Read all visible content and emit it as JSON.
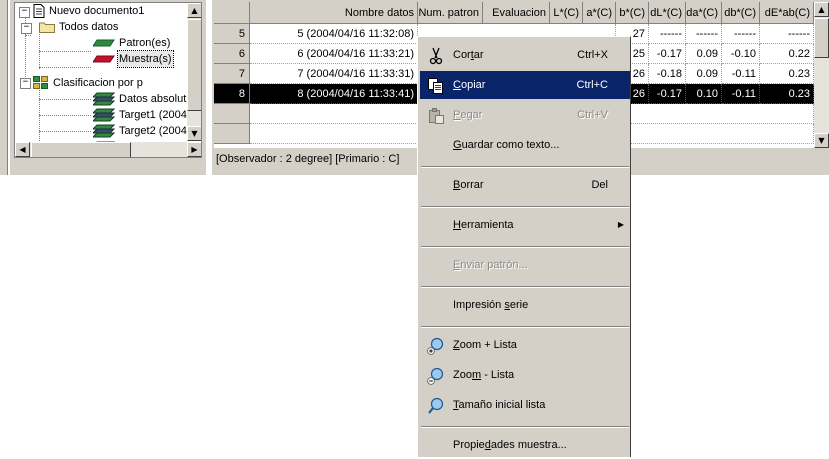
{
  "tree": {
    "nodes": [
      {
        "label": "Nuevo documento1",
        "icon": "document-icon"
      },
      {
        "label": "Todos datos",
        "icon": "folder-icon"
      },
      {
        "label": "Patron(es)",
        "icon": "green-swatch-icon"
      },
      {
        "label": "Muestra(s)",
        "icon": "red-swatch-icon"
      },
      {
        "label": "Clasificacion por p",
        "icon": "classification-icon"
      },
      {
        "label": "Datos absolut",
        "icon": "swatch-stack-icon"
      },
      {
        "label": "Target1 (2004",
        "icon": "swatch-stack-icon"
      },
      {
        "label": "Target2 (2004",
        "icon": "swatch-stack-icon"
      }
    ]
  },
  "grid": {
    "headers": [
      "Nombre datos",
      "Num. patron",
      "Evaluacion",
      "L*(C)",
      "a*(C)",
      "b*(C)",
      "dL*(C)",
      "da*(C)",
      "db*(C)",
      "dE*ab(C)"
    ],
    "rows": [
      {
        "num": "5",
        "name": "5 (2004/04/16 11:32:08)",
        "b": "27",
        "dL": "------",
        "da": "------",
        "db": "------",
        "dE": "------"
      },
      {
        "num": "6",
        "name": "6 (2004/04/16 11:33:21)",
        "b": "25",
        "dL": "-0.17",
        "da": "0.09",
        "db": "-0.10",
        "dE": "0.22"
      },
      {
        "num": "7",
        "name": "7 (2004/04/16 11:33:31)",
        "b": "26",
        "dL": "-0.18",
        "da": "0.09",
        "db": "-0.11",
        "dE": "0.23"
      },
      {
        "num": "8",
        "name": "8 (2004/04/16 11:33:41)",
        "b": "26",
        "dL": "-0.17",
        "da": "0.10",
        "db": "-0.11",
        "dE": "0.23"
      }
    ],
    "status": "[Observador : 2 degree]  [Primario : C]"
  },
  "menu": {
    "cut": {
      "pre": "Cor",
      "u": "t",
      "post": "ar",
      "shortcut": "Ctrl+X"
    },
    "copy": {
      "pre": "",
      "u": "C",
      "post": "opiar",
      "shortcut": "Ctrl+C"
    },
    "paste": {
      "pre": "",
      "u": "P",
      "post": "egar",
      "shortcut": "Ctrl+V"
    },
    "save_text": {
      "pre": "",
      "u": "G",
      "post": "uardar como texto..."
    },
    "delete": {
      "pre": "",
      "u": "B",
      "post": "orrar",
      "shortcut": "Del"
    },
    "tool": {
      "pre": "",
      "u": "H",
      "post": "erramienta"
    },
    "send_pattern": {
      "pre": "",
      "u": "E",
      "post": "nviar patrón..."
    },
    "print_series": {
      "pre": "Impresión ",
      "u": "s",
      "post": "erie"
    },
    "zoom_plus": {
      "pre": "",
      "u": "Z",
      "post": "oom + Lista"
    },
    "zoom_minus": {
      "pre": "Zoo",
      "u": "m",
      "post": " - Lista"
    },
    "initial_size": {
      "pre": "",
      "u": "T",
      "post": "amaño inicial lista"
    },
    "properties": {
      "pre": "Propie",
      "u": "d",
      "post": "ades muestra..."
    }
  }
}
